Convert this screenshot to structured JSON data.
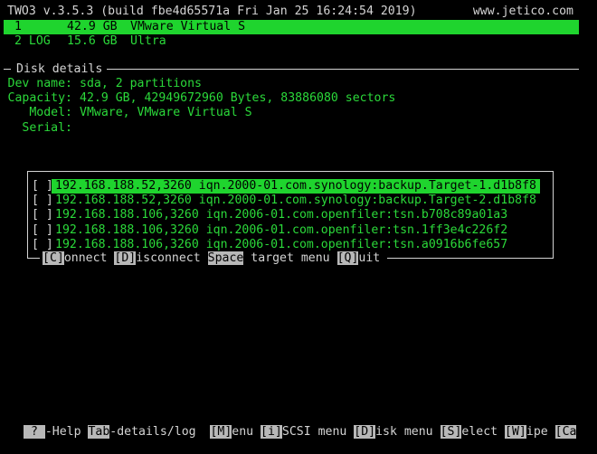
{
  "header": {
    "title": "TWO3 v.3.5.3 (build fbe4d65571a Fri Jan 25 16:24:54 2019)",
    "site": "www.jetico.com"
  },
  "disks": [
    {
      "num": "1",
      "size": "42.9 GB",
      "name": "VMware Virtual S",
      "selected": true
    },
    {
      "num": "2 LOG",
      "size": "15.6 GB",
      "name": "Ultra",
      "selected": false
    }
  ],
  "details": {
    "section_title": "Disk details",
    "rows": [
      {
        "label": "Dev name:",
        "value": "sda, 2 partitions"
      },
      {
        "label": "Capacity:",
        "value": "42.9 GB, 42949672960 Bytes, 83886080 sectors"
      },
      {
        "label": "Model:",
        "value": "VMware, VMware Virtual S"
      },
      {
        "label": "Serial:",
        "value": ""
      }
    ]
  },
  "targets": [
    {
      "checkbox": "[ ]",
      "text": "192.168.188.52,3260 iqn.2000-01.com.synology:backup.Target-1.d1b8f8",
      "selected": true
    },
    {
      "checkbox": "[ ]",
      "text": "192.168.188.52,3260 iqn.2000-01.com.synology:backup.Target-2.d1b8f8",
      "selected": false
    },
    {
      "checkbox": "[ ]",
      "text": "192.168.188.106,3260 iqn.2006-01.com.openfiler:tsn.b708c89a01a3",
      "selected": false
    },
    {
      "checkbox": "[ ]",
      "text": "192.168.188.106,3260 iqn.2006-01.com.openfiler:tsn.1ff3e4c226f2",
      "selected": false
    },
    {
      "checkbox": "[ ]",
      "text": "192.168.188.106,3260 iqn.2006-01.com.openfiler:tsn.a0916b6fe657",
      "selected": false
    }
  ],
  "dialog_menu": [
    {
      "key": "[C]",
      "rest": "onnect "
    },
    {
      "key": "[D]",
      "rest": "isconnect "
    },
    {
      "key": "Space",
      "rest": " target menu "
    },
    {
      "key": "[Q]",
      "rest": "uit"
    }
  ],
  "footer": [
    {
      "key": " ? ",
      "rest": "-Help "
    },
    {
      "key": "Tab",
      "rest": "-details/log  "
    },
    {
      "key": "[M]",
      "rest": "enu "
    },
    {
      "key": "[i]",
      "rest": "SCSI menu "
    },
    {
      "key": "[D]",
      "rest": "isk menu "
    },
    {
      "key": "[S]",
      "rest": "elect "
    },
    {
      "key": "[W]",
      "rest": "ipe "
    },
    {
      "key": "[Ca",
      "rest": ""
    }
  ],
  "colors": {
    "text_green": "#2bd93a",
    "highlight_green": "#1fd42e",
    "text_white": "#d4d4d4",
    "key_bg": "#b8b8b8",
    "background": "#000000"
  }
}
